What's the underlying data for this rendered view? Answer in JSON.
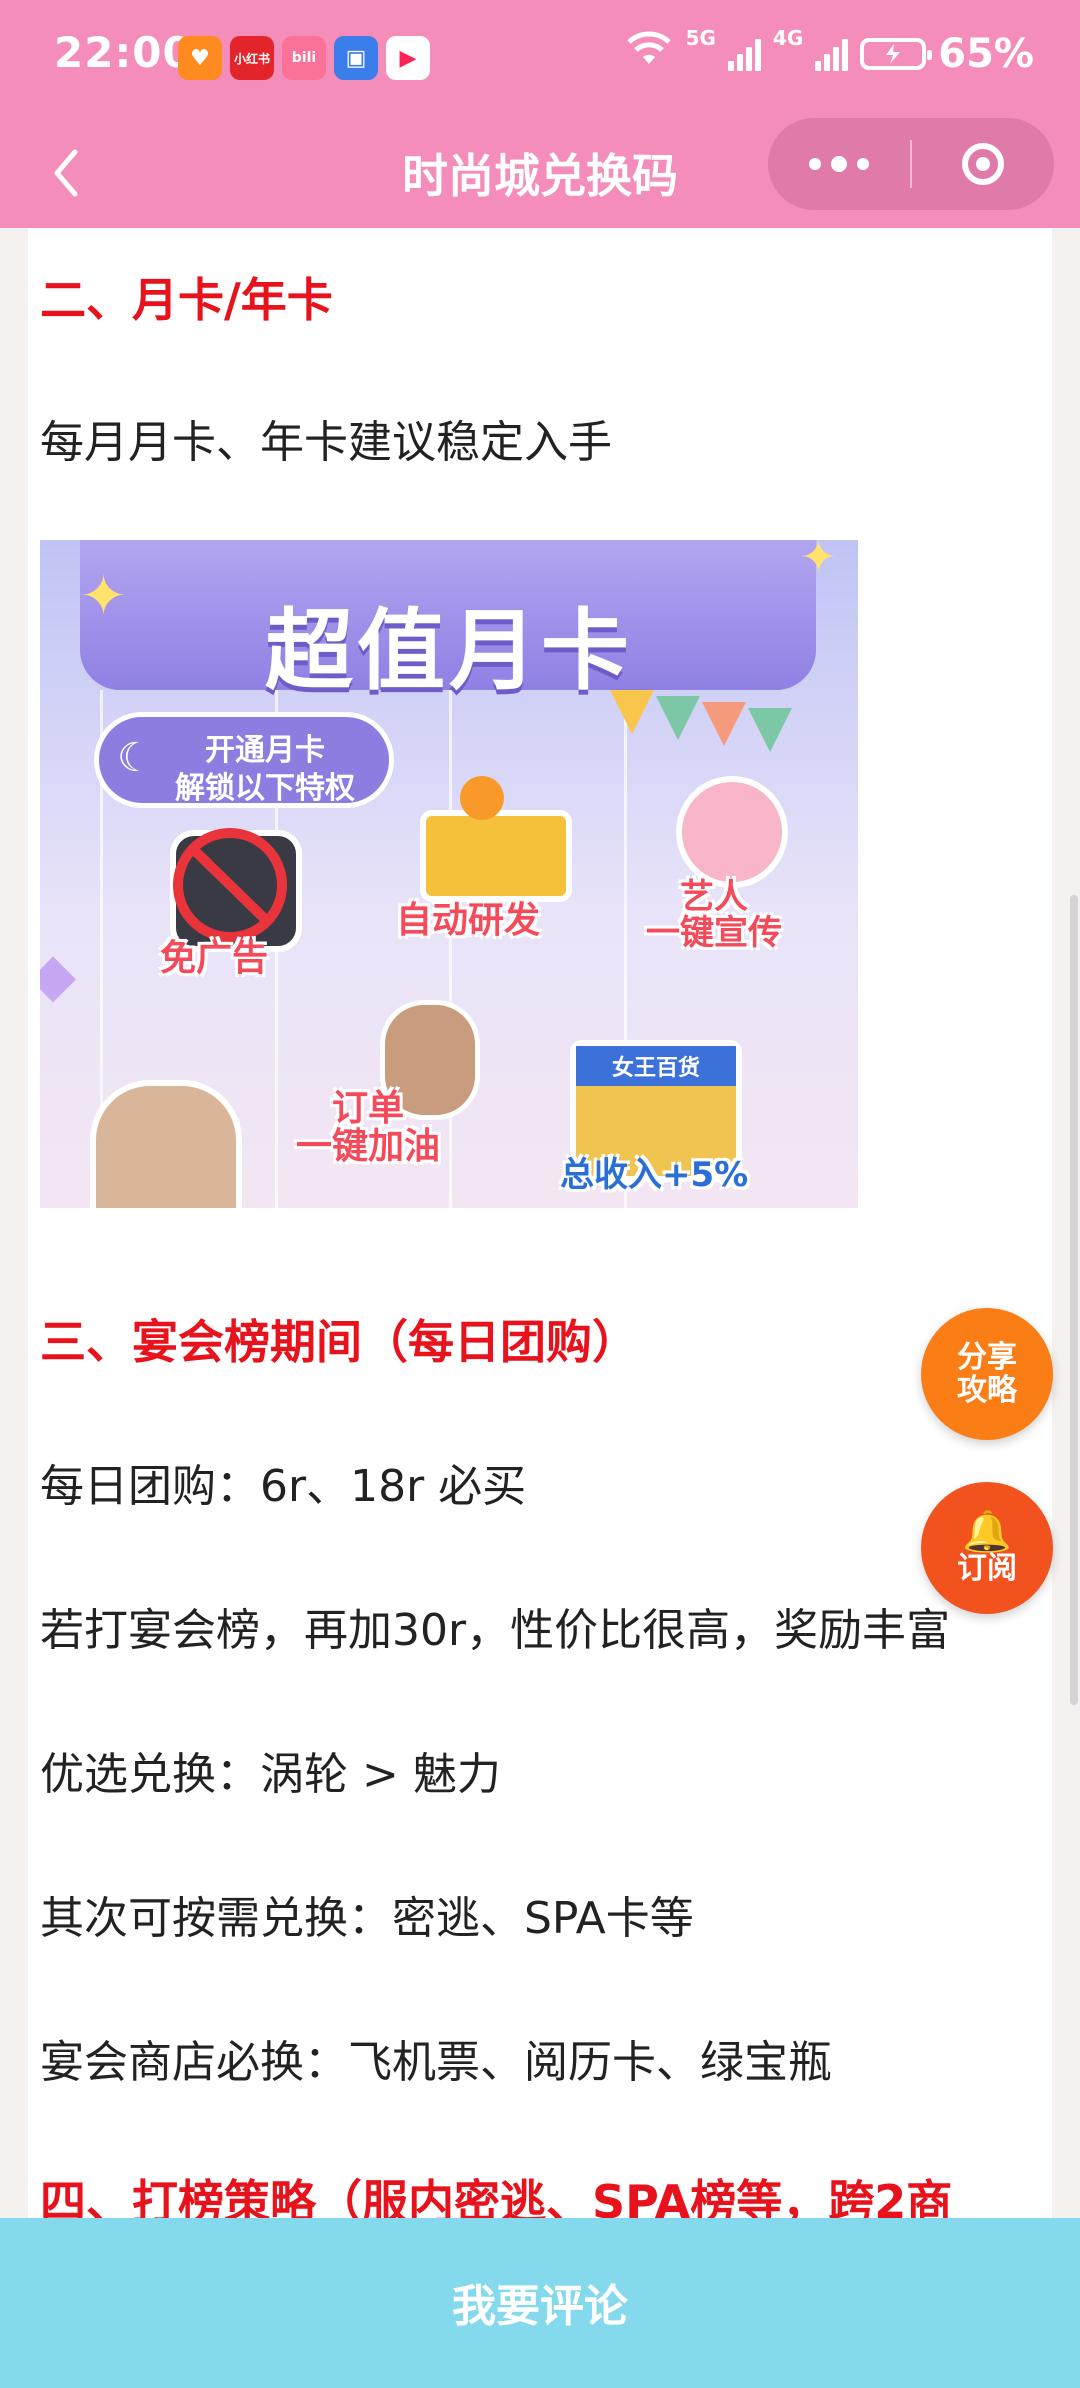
{
  "status_bar": {
    "time": "22:00",
    "network_5g": "5G",
    "network_4g": "4G",
    "battery_percent": "65%",
    "apps": [
      {
        "icon": "heart-app-icon",
        "label": "",
        "color": "#ff8a1f"
      },
      {
        "icon": "xiaohongshu-app-icon",
        "label": "小红书",
        "color": "#e3242b"
      },
      {
        "icon": "bilibili-app-icon",
        "label": "bili",
        "color": "#fb7299"
      },
      {
        "icon": "id-card-app-icon",
        "label": "",
        "color": "#3b7dea"
      },
      {
        "icon": "play-app-icon",
        "label": "",
        "color": "#ff2255"
      }
    ]
  },
  "nav": {
    "title": "时尚城兑换码"
  },
  "article": {
    "section2_title": "二、月卡/年卡",
    "section2_p1": "每月月卡、年卡建议稳定入手",
    "image": {
      "title": "超值月卡",
      "pill_line1": "开通月卡",
      "pill_line2": "解锁以下特权",
      "perk_no_ads": "免广告",
      "perk_auto_dev": "自动研发",
      "perk_artist_l1": "艺人",
      "perk_artist_l2": "一键宣传",
      "perk_order_l1": "订单",
      "perk_order_l2": "一键加油",
      "perk_income": "总收入+5%",
      "shop_sign": "女王百货"
    },
    "section3_title": "三、宴会榜期间（每日团购）",
    "section3_p1": "每日团购：6r、18r 必买",
    "section3_p2": "若打宴会榜，再加30r，性价比很高，奖励丰富",
    "section3_p3": "优选兑换：涡轮 > 魅力",
    "section3_p4": "其次可按需兑换：密逃、SPA卡等",
    "section3_p5": "宴会商店必换：飞机票、阅历卡、绿宝瓶",
    "section4_title": "四、打榜策略（服内密逃、SPA榜等，跨2商"
  },
  "fab": {
    "share_line1": "分享",
    "share_line2": "攻略",
    "subscribe_label": "订阅"
  },
  "bottom_bar": {
    "comment_label": "我要评论"
  },
  "colors": {
    "theme_pink": "#f48dba",
    "heading_red": "#e8121c",
    "fab_orange": "#fb7d16",
    "bottom_bar": "#84d9ed"
  }
}
